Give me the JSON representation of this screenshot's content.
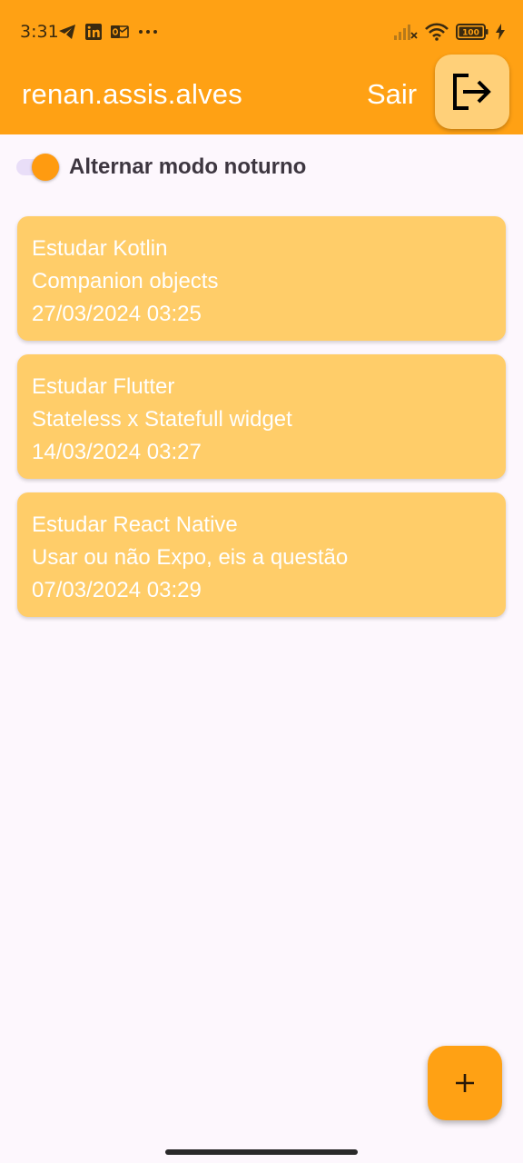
{
  "status_bar": {
    "time": "3:31",
    "left_icons": [
      "telegram-icon",
      "linkedin-icon",
      "outlook-icon",
      "more-dots-icon"
    ],
    "right_icons": [
      "signal-icon",
      "wifi-icon",
      "battery-icon",
      "charging-icon"
    ],
    "battery_level": "100"
  },
  "app_bar": {
    "title": "renan.assis.alves",
    "logout_label": "Sair",
    "logout_icon": "logout-icon"
  },
  "dark_mode_toggle": {
    "label": "Alternar modo noturno",
    "on": true
  },
  "tasks": [
    {
      "title": "Estudar Kotlin",
      "description": "Companion objects",
      "datetime": "27/03/2024 03:25"
    },
    {
      "title": "Estudar Flutter",
      "description": "Stateless x Statefull widget",
      "datetime": "14/03/2024 03:27"
    },
    {
      "title": "Estudar React Native",
      "description": "Usar ou não Expo, eis a questão",
      "datetime": "07/03/2024 03:29"
    }
  ],
  "fab": {
    "icon": "plus-icon"
  },
  "colors": {
    "primary": "#ffa114",
    "card": "#ffcd69",
    "background": "#fdf7fd",
    "logout_button": "#ffd079"
  }
}
